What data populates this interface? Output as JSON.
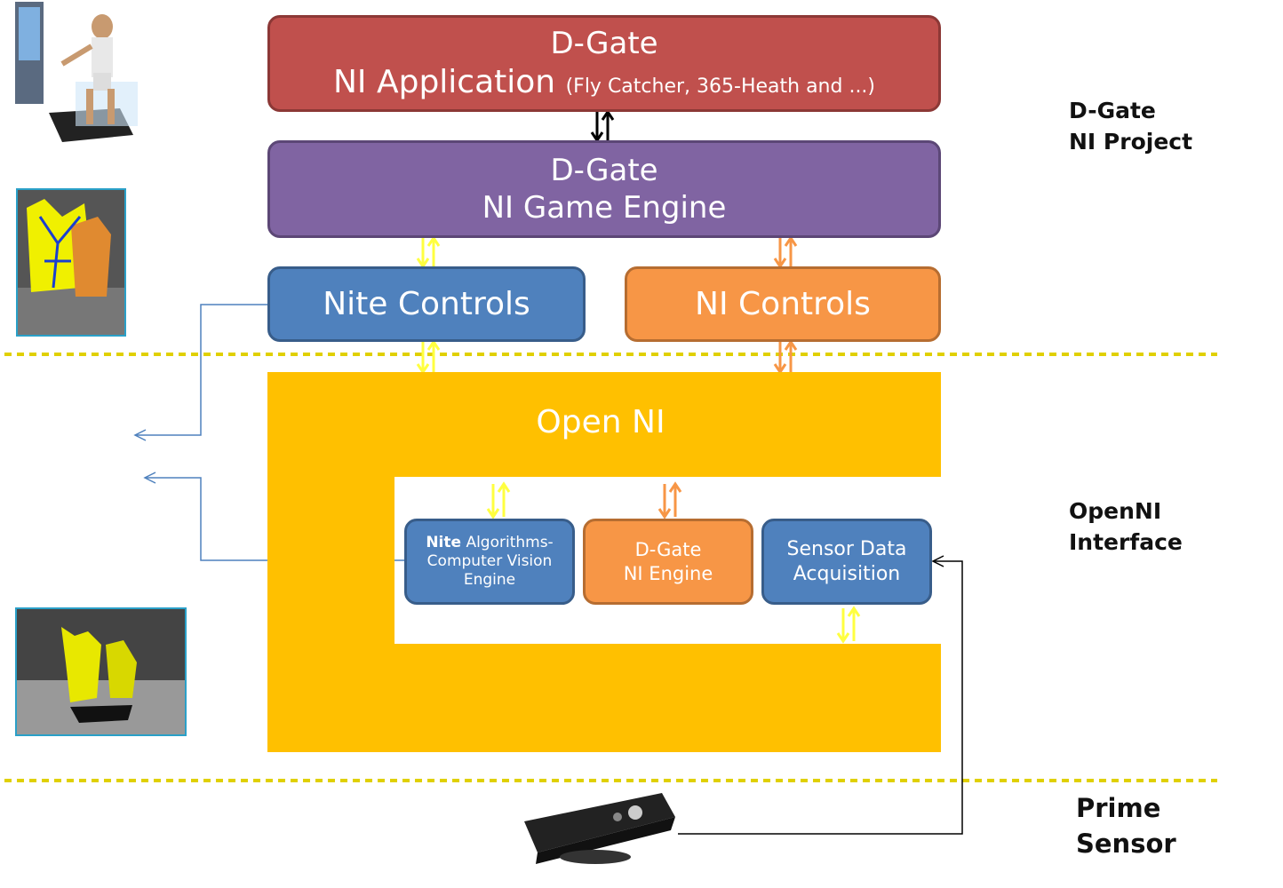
{
  "layers": {
    "app": {
      "line1": "D-Gate",
      "line2": "NI Application",
      "note": "(Fly Catcher, 365-Heath and ...)"
    },
    "game_engine": {
      "line1": "D-Gate",
      "line2": "NI Game Engine"
    },
    "nite_controls": "Nite Controls",
    "ni_controls": "NI Controls",
    "openni": "Open NI",
    "nite_algorithms": {
      "bold": "Nite",
      "rest": "Algorithms-",
      "line2": "Computer Vision",
      "line3": "Engine"
    },
    "dgate_ni_engine": {
      "line1": "D-Gate",
      "line2": "NI Engine"
    },
    "sensor_data": {
      "line1": "Sensor Data",
      "line2": "Acquisition"
    }
  },
  "side_labels": {
    "project": {
      "line1": "D-Gate",
      "line2": "NI Project"
    },
    "openni": {
      "line1": "OpenNI",
      "line2": "Interface"
    },
    "sensor": {
      "line1": "Prime",
      "line2": "Sensor"
    }
  },
  "colors": {
    "red": "#c0504d",
    "purple": "#8064a2",
    "blue": "#4f81bd",
    "orange": "#f79646",
    "yellow": "#ffc000",
    "arrow_yellow": "#ffff40",
    "arrow_orange": "#f79646",
    "connector": "#4f81bd"
  }
}
